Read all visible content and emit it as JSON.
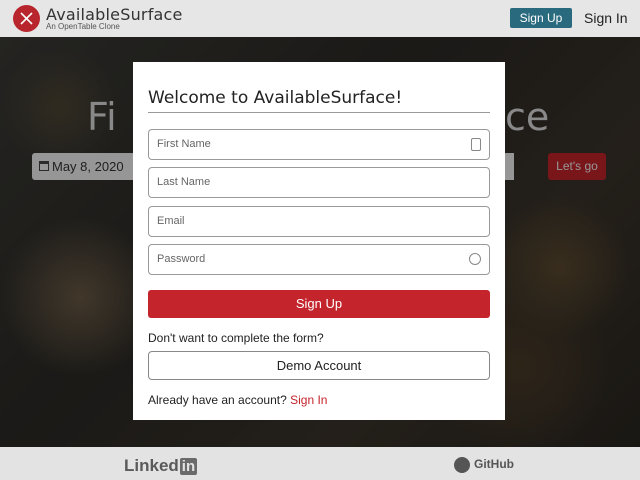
{
  "header": {
    "brand": "AvailableSurface",
    "tagline": "An OpenTable Clone",
    "signup_label": "Sign Up",
    "signin_label": "Sign In"
  },
  "hero": {
    "title_left": "Fi",
    "title_right": "ce",
    "date_value": "May 8, 2020",
    "lets_go_label": "Let's go"
  },
  "modal": {
    "title": "Welcome to AvailableSurface!",
    "first_name_placeholder": "First Name",
    "last_name_placeholder": "Last Name",
    "email_placeholder": "Email",
    "password_placeholder": "Password",
    "signup_label": "Sign Up",
    "demo_prompt": "Don't want to complete the form?",
    "demo_label": "Demo Account",
    "account_prompt": "Already have an account?",
    "signin_link": "Sign In"
  },
  "footer": {
    "linkedin_text": "Linked",
    "linkedin_in": "in",
    "github_text": "GitHub"
  },
  "colors": {
    "brand_red": "#c4242b",
    "header_button": "#2a6a7e"
  }
}
